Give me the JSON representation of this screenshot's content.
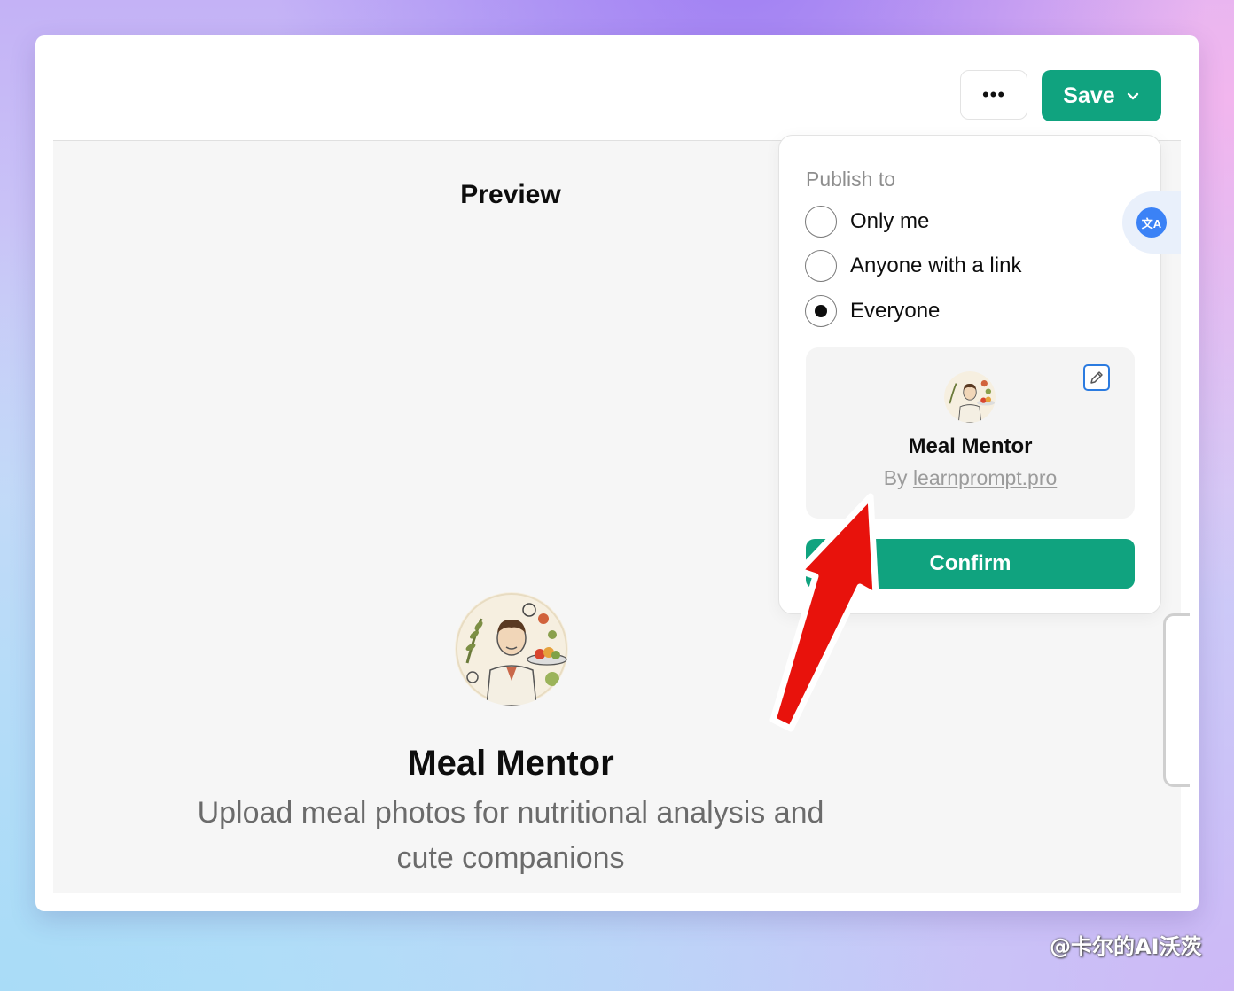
{
  "toolbar": {
    "more_label": "•••",
    "save_label": "Save"
  },
  "preview": {
    "title": "Preview",
    "gpt_name": "Meal Mentor",
    "gpt_description": "Upload meal photos for nutritional analysis and cute companions"
  },
  "publish": {
    "heading": "Publish to",
    "options": [
      {
        "label": "Only me",
        "selected": false
      },
      {
        "label": "Anyone with a link",
        "selected": false
      },
      {
        "label": "Everyone",
        "selected": true
      }
    ],
    "card": {
      "name": "Meal Mentor",
      "by_prefix": "By ",
      "author": "learnprompt.pro"
    },
    "confirm_label": "Confirm"
  },
  "translate_icon": "translate-icon",
  "watermark": "@卡尔的AI沃茨",
  "colors": {
    "accent": "#10a37f",
    "link_blue": "#2b7be0",
    "annotation_arrow": "#e8120c"
  }
}
